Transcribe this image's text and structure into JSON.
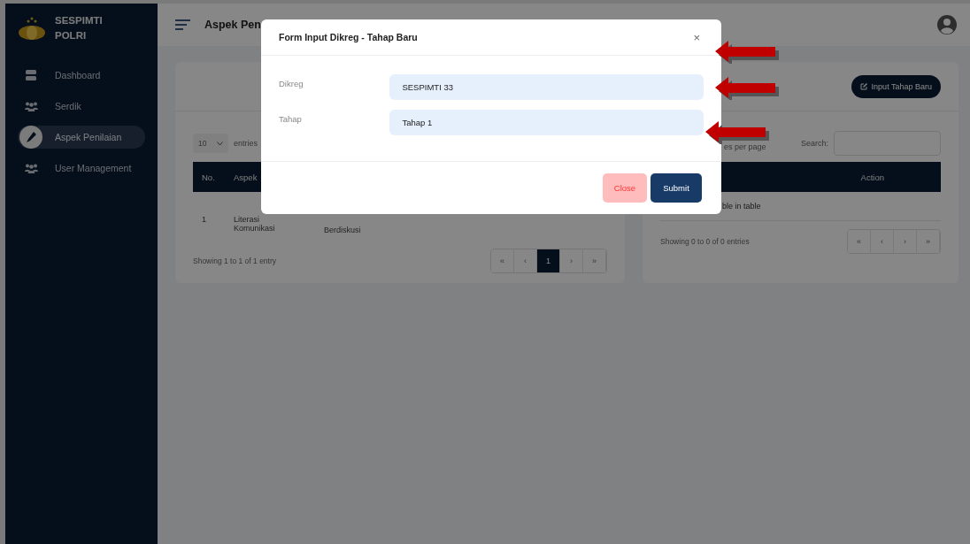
{
  "brand": {
    "line1": "SESPIMTI",
    "line2": "POLRI"
  },
  "sidebar": {
    "items": [
      {
        "label": "Dashboard",
        "kind": "server",
        "selected": false
      },
      {
        "label": "Serdik",
        "kind": "users",
        "selected": false
      },
      {
        "label": "Aspek Penilaian",
        "kind": "pen",
        "selected": true
      },
      {
        "label": "User Management",
        "kind": "users",
        "selected": false
      }
    ]
  },
  "topbar": {
    "title": "Aspek Pen"
  },
  "left_card": {
    "page_size": "10",
    "entries_label": "entries",
    "columns": [
      "No.",
      "Aspek"
    ],
    "rows": [
      {
        "no": "1",
        "aspek": "Literasi Komunikasi",
        "column_3": "Berdiskusi"
      }
    ],
    "info": "Showing 1 to 1 of 1 entry",
    "pagination": [
      {
        "label": "«",
        "selected": false
      },
      {
        "label": "‹",
        "selected": false
      },
      {
        "label": "1",
        "selected": true
      },
      {
        "label": "›",
        "selected": false
      },
      {
        "label": "»",
        "selected": false
      }
    ]
  },
  "right_card": {
    "button": "Input Tahap Baru",
    "per_page_label": "es per page",
    "search_label": "Search:",
    "columns": [
      "Action"
    ],
    "empty_message": "ble in table",
    "info": "Showing 0 to 0 of 0 entries",
    "pagination": [
      {
        "label": "«",
        "selected": false
      },
      {
        "label": "‹",
        "selected": false
      },
      {
        "label": "›",
        "selected": false
      },
      {
        "label": "»",
        "selected": false
      }
    ]
  },
  "modal": {
    "title": "Form Input Dikreg - Tahap Baru",
    "close": "×",
    "fields": [
      {
        "label": "Dikreg",
        "value": "SESPIMTI 33"
      },
      {
        "label": "Tahap",
        "value": "Tahap 1"
      }
    ],
    "buttons": [
      {
        "label": "Close",
        "kind": "secondary"
      },
      {
        "label": "Submit",
        "kind": "primary"
      }
    ]
  }
}
